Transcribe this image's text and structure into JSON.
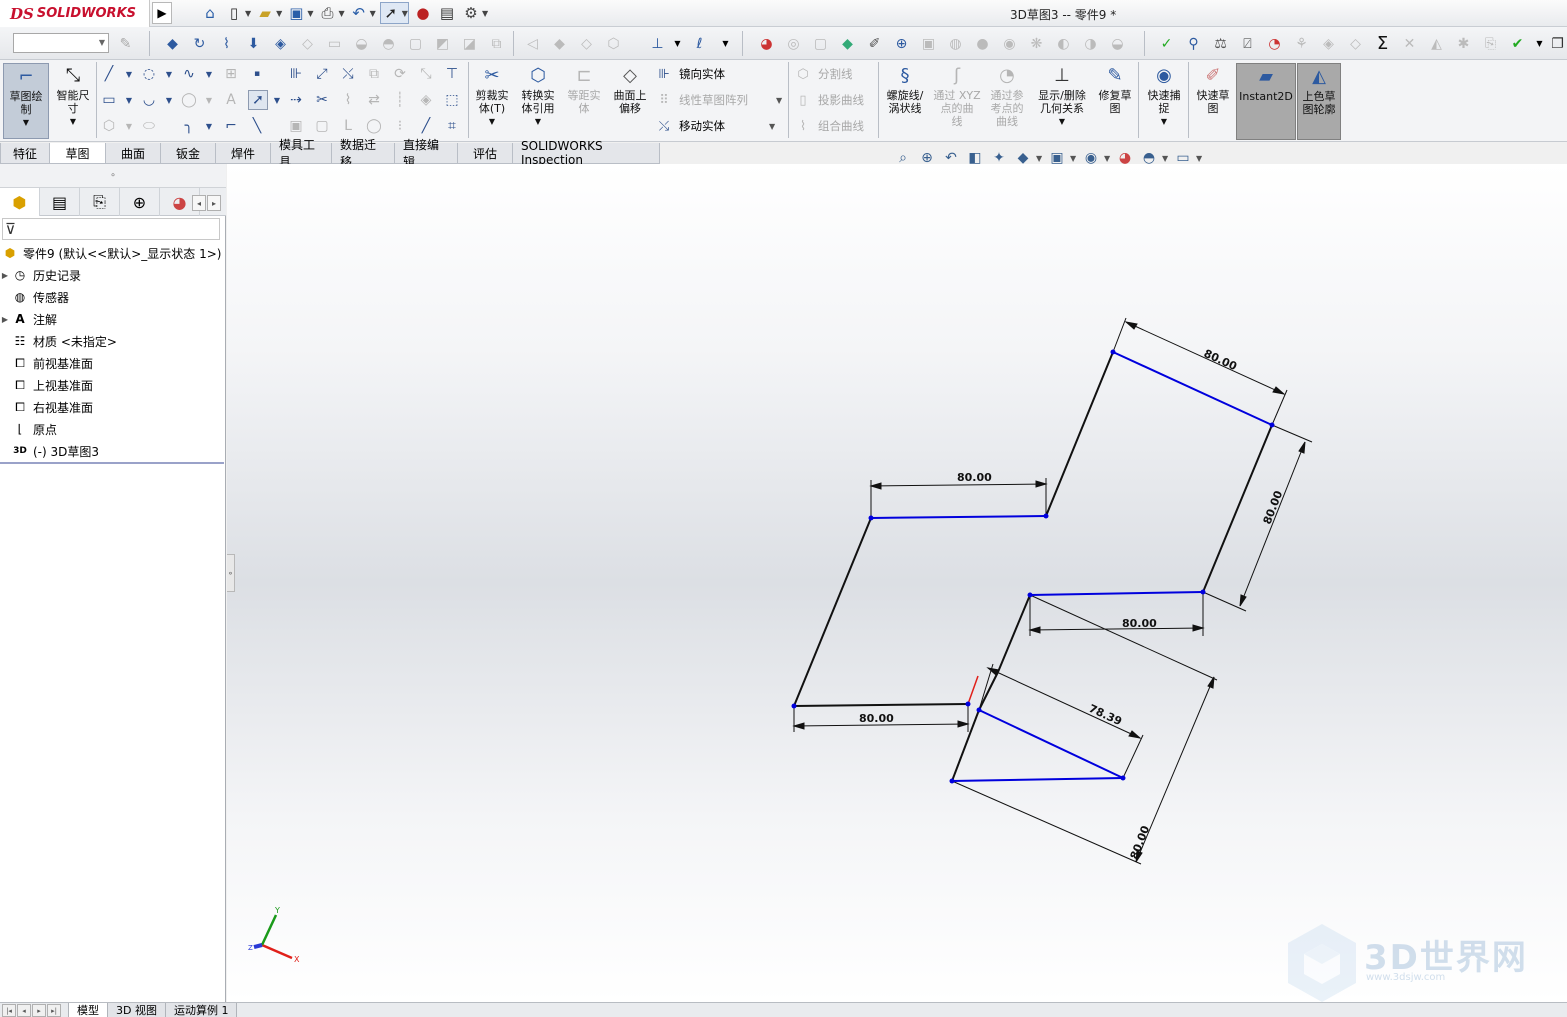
{
  "app": {
    "logo_ds": "DS",
    "logo_text": "SOLIDWORKS",
    "document_title": "3D草图3 -- 零件9 *"
  },
  "colors": {
    "brand_red": "#c8102e",
    "sketch_black": "#111111",
    "sketch_blue": "#0000dd",
    "axis_red": "#e0201a",
    "axis_green": "#1a9a1a",
    "axis_blue": "#2a3ad6"
  },
  "quick_access": [
    {
      "name": "home-icon",
      "glyph": "⌂"
    },
    {
      "name": "new-document-icon",
      "glyph": "🗋"
    },
    {
      "name": "open-icon",
      "glyph": "📂"
    },
    {
      "name": "save-icon",
      "glyph": "💾"
    },
    {
      "name": "print-icon",
      "glyph": "🖶"
    },
    {
      "name": "undo-icon",
      "glyph": "↶"
    },
    {
      "name": "select-pointer-icon",
      "glyph": "➚"
    },
    {
      "name": "rebuild-icon",
      "glyph": "🚦"
    },
    {
      "name": "file-properties-icon",
      "glyph": "▤"
    },
    {
      "name": "options-gear-icon",
      "glyph": "⚙"
    }
  ],
  "command_manager": {
    "sketch_button": "草图绘\n制",
    "smart_dimension": "智能尺\n寸",
    "trim_entities": "剪裁实\n体(T)",
    "convert_entities": "转换实\n体引用",
    "offset_entities": "等距实\n体",
    "offset_on_surface": "曲面上\n偏移",
    "mirror_entities": "镜向实体",
    "linear_pattern": "线性草图阵列",
    "move_entities": "移动实体",
    "split_line": "分割线",
    "projected_curve": "投影曲线",
    "composite_curve": "组合曲线",
    "helix": "螺旋线/\n涡状线",
    "curve_xyz": "通过 XYZ\n点的曲\n线",
    "curve_reference": "通过参\n考点的\n曲线",
    "display_relations": "显示/删除\n几何关系",
    "repair_sketch": "修复草\n图",
    "quick_snaps": "快速捕\n捉",
    "rapid_sketch": "快速草\n图",
    "instant2d": "Instant2D",
    "shaded_sketch_contours": "上色草\n图轮廓"
  },
  "tabs": [
    "特征",
    "草图",
    "曲面",
    "钣金",
    "焊件",
    "模具工具",
    "数据迁移",
    "直接编辑",
    "评估",
    "SOLIDWORKS Inspection"
  ],
  "active_tab": "草图",
  "feature_tree": {
    "root": "零件9  (默认<<默认>_显示状态 1>)",
    "items": [
      {
        "label": "历史记录",
        "expandable": true,
        "icon": "history-icon"
      },
      {
        "label": "传感器",
        "expandable": false,
        "icon": "sensor-icon"
      },
      {
        "label": "注解",
        "expandable": true,
        "icon": "annotations-icon"
      },
      {
        "label": "材质 <未指定>",
        "expandable": false,
        "icon": "material-icon"
      },
      {
        "label": "前视基准面",
        "expandable": false,
        "icon": "plane-icon"
      },
      {
        "label": "上视基准面",
        "expandable": false,
        "icon": "plane-icon"
      },
      {
        "label": "右视基准面",
        "expandable": false,
        "icon": "plane-icon"
      },
      {
        "label": "原点",
        "expandable": false,
        "icon": "origin-icon"
      },
      {
        "label": "(-) 3D草图3",
        "expandable": false,
        "icon": "3d-sketch-icon"
      }
    ]
  },
  "sketch": {
    "dimensions": [
      {
        "id": "dim-top-right",
        "text": "80.00"
      },
      {
        "id": "dim-upper-left",
        "text": "80.00"
      },
      {
        "id": "dim-right-vertical",
        "text": "80.00"
      },
      {
        "id": "dim-middle",
        "text": "80.00"
      },
      {
        "id": "dim-bottom-left",
        "text": "80.00"
      },
      {
        "id": "dim-diagonal",
        "text": "78.39"
      },
      {
        "id": "dim-lower-right",
        "text": "80.00"
      }
    ],
    "triad_axes": {
      "x": "X",
      "y": "Y",
      "z": "Z"
    }
  },
  "watermark": {
    "title": "3D世界网",
    "url": "www.3dsjw.com"
  },
  "bottom_tabs": [
    "模型",
    "3D 视图",
    "运动算例 1"
  ],
  "active_bottom_tab": "模型"
}
